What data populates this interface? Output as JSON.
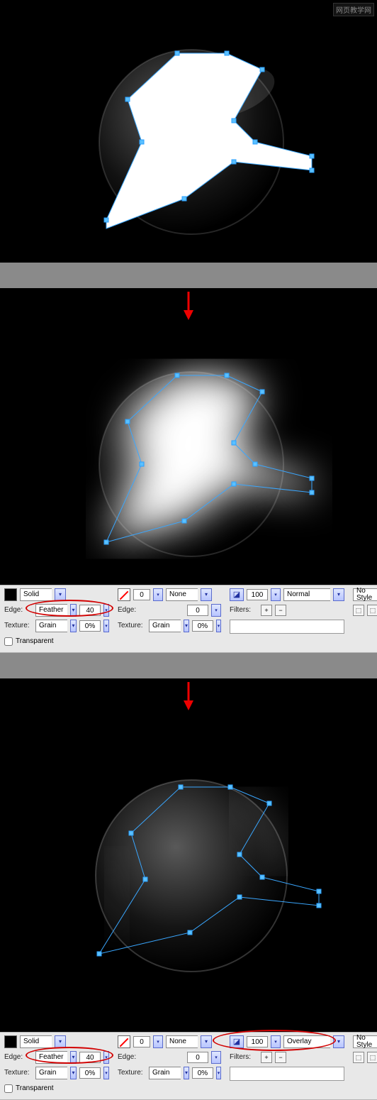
{
  "watermark": "网页教学网",
  "panel1": {
    "fillType": "Solid",
    "edgeMode": "Feather",
    "edgeValue": "40",
    "textureMode": "Grain",
    "textureAmount": "0%",
    "transparentLabel": "Transparent",
    "transparentChecked": false,
    "strokeNone": "None",
    "strokeEdgeLabel": "Edge:",
    "strokeEdgeValue": "0",
    "strokeTextureMode": "Grain",
    "strokeTextureAmount": "0%",
    "strokeWidthValue": "0",
    "opacityIconValue": "100",
    "blendMode": "Normal",
    "filtersLabel": "Filters:",
    "noStyleLabel": "No Style",
    "edgeLabel": "Edge:",
    "textureLabel": "Texture:"
  },
  "panel2": {
    "fillType": "Solid",
    "edgeMode": "Feather",
    "edgeValue": "40",
    "textureMode": "Grain",
    "textureAmount": "0%",
    "transparentLabel": "Transparent",
    "transparentChecked": false,
    "strokeNone": "None",
    "strokeEdgeLabel": "Edge:",
    "strokeEdgeValue": "0",
    "strokeTextureMode": "Grain",
    "strokeTextureAmount": "0%",
    "strokeWidthValue": "0",
    "opacityIconValue": "100",
    "blendMode": "Overlay",
    "filtersLabel": "Filters:",
    "noStyleLabel": "No Style",
    "edgeLabel": "Edge:",
    "textureLabel": "Texture:"
  }
}
